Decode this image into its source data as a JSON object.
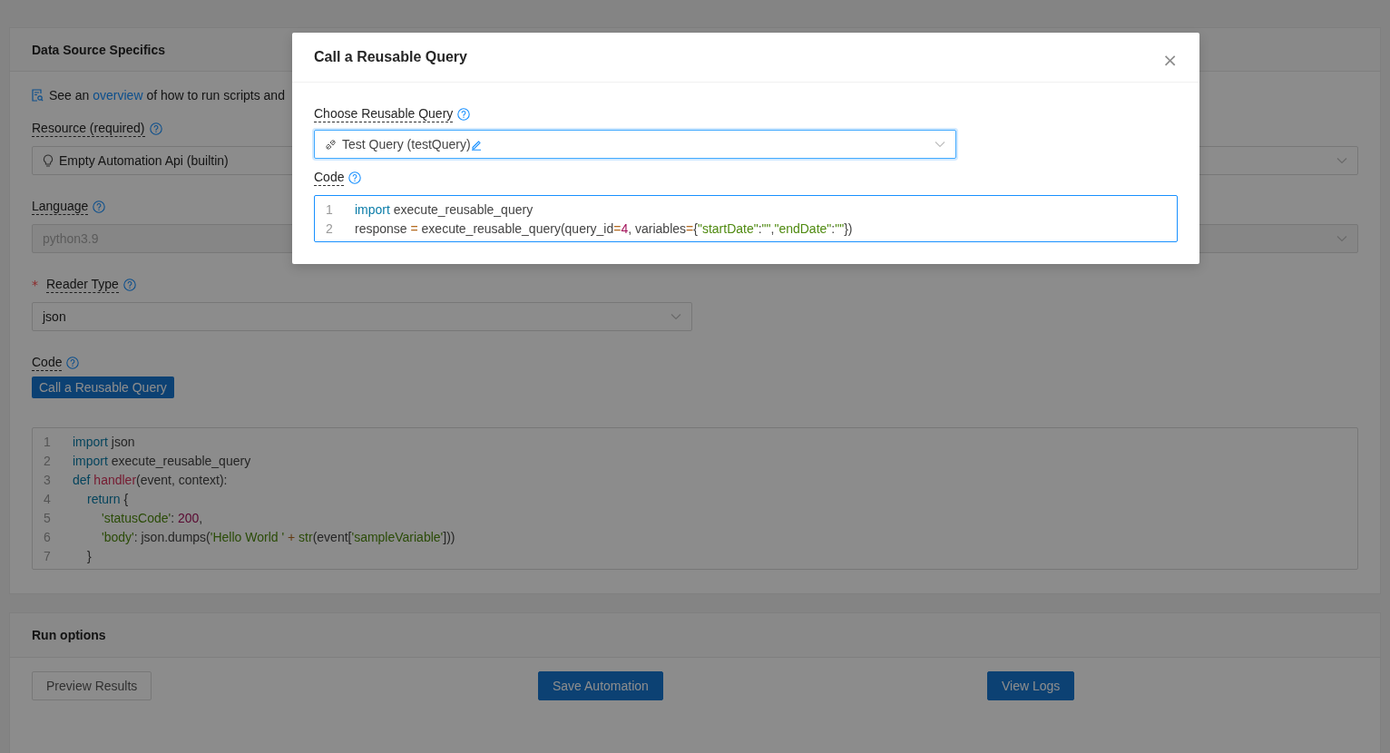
{
  "data_source": {
    "title": "Data Source Specifics",
    "overview": {
      "before": "See an ",
      "link": "overview",
      "after": " of how to run scripts and"
    },
    "fields": [
      {
        "kind": "select",
        "label": "Resource (required)",
        "value": "Empty Automation Api (builtin)",
        "disabled": false
      },
      {
        "kind": "select",
        "label": "Language",
        "value": "python3.9",
        "disabled": true
      },
      {
        "kind": "select",
        "required_mark": "*",
        "label": "Reader Type",
        "value": "json",
        "disabled": false
      }
    ],
    "code": {
      "label": "Code",
      "button": "Call a Reusable Query",
      "lines": [
        {
          "number": "1",
          "tokens": [
            {
              "kind": "keyword",
              "text": "import"
            },
            {
              "kind": "plain",
              "text": " json"
            }
          ]
        },
        {
          "number": "2",
          "tokens": [
            {
              "kind": "keyword",
              "text": "import"
            },
            {
              "kind": "plain",
              "text": " execute_reusable_query"
            }
          ]
        },
        {
          "number": "3",
          "tokens": [
            {
              "kind": "keyword",
              "text": "def "
            },
            {
              "kind": "function",
              "text": "handler"
            },
            {
              "kind": "plain",
              "text": "(event, context):"
            }
          ],
          "children": [
            {
              "number": "4",
              "tokens": [
                {
                  "kind": "keyword",
                  "text": "return"
                },
                {
                  "kind": "plain",
                  "text": " {"
                }
              ],
              "children": [
                {
                  "number": "5",
                  "tokens": [
                    {
                      "kind": "string",
                      "text": "'statusCode'"
                    },
                    {
                      "kind": "plain",
                      "text": ": "
                    },
                    {
                      "kind": "number",
                      "text": "200"
                    },
                    {
                      "kind": "plain",
                      "text": ","
                    }
                  ]
                },
                {
                  "number": "6",
                  "tokens": [
                    {
                      "kind": "string",
                      "text": "'body'"
                    },
                    {
                      "kind": "plain",
                      "text": ": json.dumps("
                    },
                    {
                      "kind": "string",
                      "text": "'Hello World '"
                    },
                    {
                      "kind": "operator",
                      "text": " + "
                    },
                    {
                      "kind": "builtin",
                      "text": "str"
                    },
                    {
                      "kind": "plain",
                      "text": "(event["
                    },
                    {
                      "kind": "string",
                      "text": "'sampleVariable'"
                    },
                    {
                      "kind": "plain",
                      "text": "]))"
                    }
                  ]
                }
              ]
            },
            {
              "number": "7",
              "tokens": [
                {
                  "kind": "plain",
                  "text": "}"
                }
              ]
            }
          ]
        }
      ]
    }
  },
  "run_options": {
    "title": "Run options",
    "buttons": [
      {
        "label": "Preview Results",
        "kind": "default"
      },
      {
        "label": "Save Automation",
        "kind": "primary"
      },
      {
        "label": "View Logs",
        "kind": "primary"
      }
    ]
  },
  "modal": {
    "title": "Call a Reusable Query",
    "close": "×",
    "query_label": "Choose Reusable Query",
    "query_value": "Test Query (testQuery)",
    "code_label": "Code",
    "lines": [
      {
        "number": "1",
        "tokens": [
          {
            "kind": "keyword",
            "text": "import"
          },
          {
            "kind": "plain",
            "text": " execute_reusable_query"
          }
        ]
      },
      {
        "number": "2",
        "tokens": [
          {
            "kind": "plain",
            "text": "response "
          },
          {
            "kind": "operator",
            "text": "="
          },
          {
            "kind": "plain",
            "text": " execute_reusable_query(query_id"
          },
          {
            "kind": "operator",
            "text": "="
          },
          {
            "kind": "number",
            "text": "4"
          },
          {
            "kind": "plain",
            "text": ", variables"
          },
          {
            "kind": "operator",
            "text": "="
          },
          {
            "kind": "plain",
            "text": "{"
          },
          {
            "kind": "string",
            "text": "\"startDate\""
          },
          {
            "kind": "plain",
            "text": ":"
          },
          {
            "kind": "string",
            "text": "\"\""
          },
          {
            "kind": "plain",
            "text": ","
          },
          {
            "kind": "string",
            "text": "\"endDate\""
          },
          {
            "kind": "plain",
            "text": ":"
          },
          {
            "kind": "string",
            "text": "\"\""
          },
          {
            "kind": "plain",
            "text": "})"
          }
        ]
      }
    ]
  }
}
